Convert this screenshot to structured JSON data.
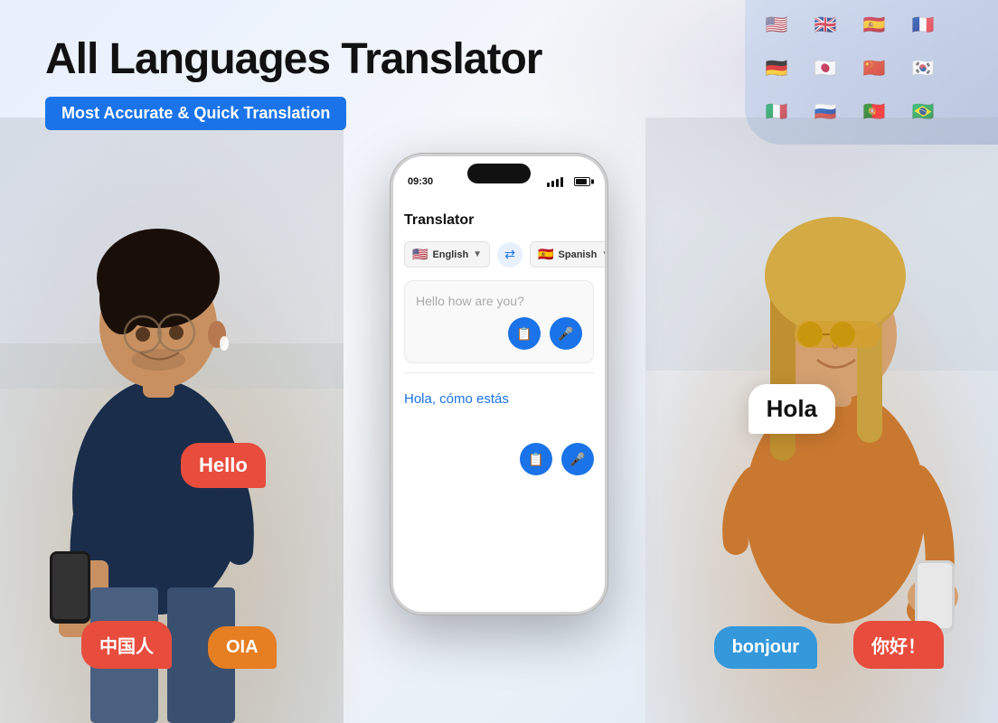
{
  "page": {
    "background_color": "#f0f4f8"
  },
  "header": {
    "main_title": "All Languages Translator",
    "subtitle_badge": "Most Accurate & Quick Translation"
  },
  "phone": {
    "time": "09:30",
    "app_title": "Translator",
    "source_lang": "English",
    "target_lang": "Spanish",
    "source_flag": "🇺🇸",
    "target_flag": "🇪🇸",
    "input_text": "Hello how are you?",
    "translated_text": "Hola, cómo estás"
  },
  "bubbles": {
    "hello": "Hello",
    "hola": "Hola",
    "chinese": "中国人",
    "oia": "OIA",
    "bonjour": "bonjour",
    "nihao": "你好！"
  },
  "flags": [
    "🇺🇸",
    "🇬🇧",
    "🇪🇸",
    "🇫🇷",
    "🇩🇪",
    "🇯🇵",
    "🇨🇳",
    "🇰🇷",
    "🇮🇹",
    "🇷🇺",
    "🇵🇹",
    "🇧🇷"
  ]
}
